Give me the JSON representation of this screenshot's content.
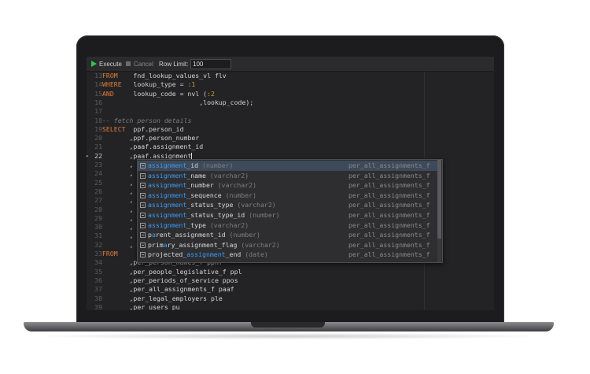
{
  "toolbar": {
    "execute_label": "Execute",
    "cancel_label": "Cancel",
    "row_limit_label": "Row Limit:",
    "row_limit_value": "100"
  },
  "editor": {
    "lines": [
      {
        "n": "13",
        "code": "FROM    fnd_lookup_values_vl flv"
      },
      {
        "n": "14",
        "code": "WHERE   lookup_type = :1"
      },
      {
        "n": "15",
        "code": "AND     lookup_code = nvl (:2"
      },
      {
        "n": "16",
        "code": "                         ,lookup_code);"
      },
      {
        "n": "17",
        "code": ""
      },
      {
        "n": "18",
        "code": "-- fetch person details"
      },
      {
        "n": "19",
        "code": "SELECT  ppf.person_id"
      },
      {
        "n": "20",
        "code": "       ,ppf.person_number"
      },
      {
        "n": "21",
        "code": "       ,paaf.assignment_id"
      },
      {
        "n": "22",
        "code": "       ,paaf.assignment"
      },
      {
        "n": "23",
        "code": "       ,"
      },
      {
        "n": "24",
        "code": "       ,"
      },
      {
        "n": "25",
        "code": "       ,"
      },
      {
        "n": "26",
        "code": "       ,"
      },
      {
        "n": "27",
        "code": "       ,"
      },
      {
        "n": "28",
        "code": "       ,"
      },
      {
        "n": "29",
        "code": "       ,"
      },
      {
        "n": "30",
        "code": "       ,"
      },
      {
        "n": "31",
        "code": "       ,"
      },
      {
        "n": "32",
        "code": "       ,"
      },
      {
        "n": "33",
        "code": "FROM"
      },
      {
        "n": "34",
        "code": "       ,per_person_names_f ppnf"
      },
      {
        "n": "35",
        "code": "       ,per_people_legislative_f ppl"
      },
      {
        "n": "36",
        "code": "       ,per_periods_of_service ppos"
      },
      {
        "n": "37",
        "code": "       ,per_all_assignments_f paaf"
      },
      {
        "n": "38",
        "code": "       ,per_legal_employers ple"
      },
      {
        "n": "39",
        "code": "       ,per_users pu"
      }
    ],
    "active_line": "22"
  },
  "autocomplete": {
    "items": [
      {
        "pre": "",
        "hl": "assignment",
        "post": "_id",
        "type": "(number)",
        "table": "per_all_assignments_f"
      },
      {
        "pre": "",
        "hl": "assignment",
        "post": "_name",
        "type": "(varchar2)",
        "table": "per_all_assignments_f"
      },
      {
        "pre": "",
        "hl": "assignment",
        "post": "_number",
        "type": "(varchar2)",
        "table": "per_all_assignments_f"
      },
      {
        "pre": "",
        "hl": "assignment",
        "post": "_sequence",
        "type": "(number)",
        "table": "per_all_assignments_f"
      },
      {
        "pre": "",
        "hl": "assignment",
        "post": "_status_type",
        "type": "(varchar2)",
        "table": "per_all_assignments_f"
      },
      {
        "pre": "",
        "hl": "assignment",
        "post": "_status_type_id",
        "type": "(number)",
        "table": "per_all_assignments_f"
      },
      {
        "pre": "",
        "hl": "assignment",
        "post": "_type",
        "type": "(varchar2)",
        "table": "per_all_assignments_f"
      },
      {
        "pre": "p",
        "hl": "a",
        "post": "rent_assignment_id",
        "type": "(number)",
        "table": "per_all_assignments_f"
      },
      {
        "pre": "prim",
        "hl": "a",
        "post": "ry_assignment_flag",
        "type": "(varchar2)",
        "table": "per_all_assignments_f"
      },
      {
        "pre": "projected_",
        "hl": "assignment",
        "post": "_end",
        "type": "(date)",
        "table": "per_all_assignments_f"
      }
    ]
  }
}
